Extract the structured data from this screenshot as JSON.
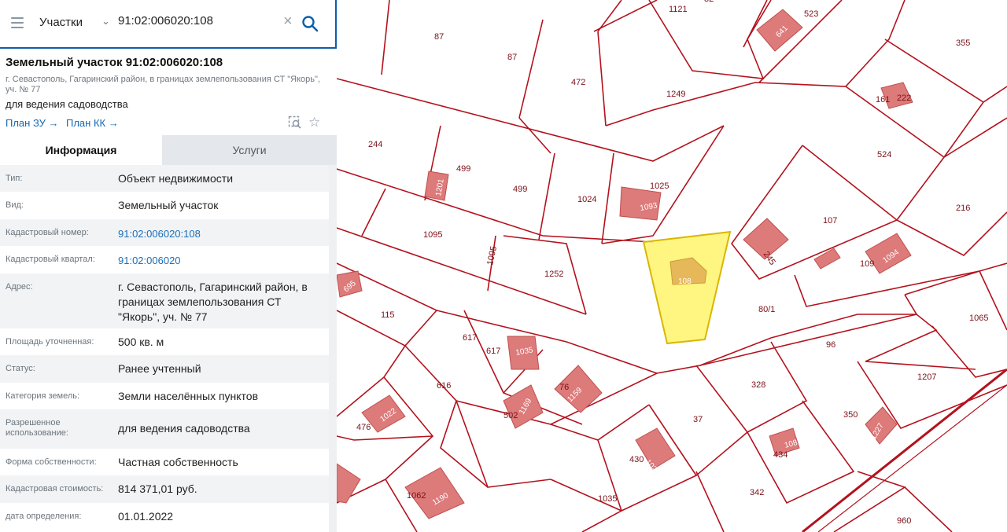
{
  "search": {
    "layer": "Участки",
    "value": "91:02:006020:108"
  },
  "object": {
    "title": "Земельный участок 91:02:006020:108",
    "address": "г. Севастополь, Гагаринский район, в границах землепользования СТ \"Якорь\", уч. № 77",
    "use": "для ведения садоводства",
    "links": [
      "План ЗУ",
      "План КК"
    ]
  },
  "tabs": [
    "Информация",
    "Услуги"
  ],
  "rows": [
    {
      "label": "Тип:",
      "value": "Объект недвижимости",
      "link": false
    },
    {
      "label": "Вид:",
      "value": "Земельный участок",
      "link": false
    },
    {
      "label": "Кадастровый номер:",
      "value": "91:02:006020:108",
      "link": true
    },
    {
      "label": "Кадастровый квартал:",
      "value": "91:02:006020",
      "link": true
    },
    {
      "label": "Адрес:",
      "value": "г. Севастополь, Гагаринский район, в границах землепользования СТ \"Якорь\", уч. № 77",
      "link": false
    },
    {
      "label": "Площадь уточненная:",
      "value": "500 кв. м",
      "link": false
    },
    {
      "label": "Статус:",
      "value": "Ранее учтенный",
      "link": false
    },
    {
      "label": "Категория земель:",
      "value": "Земли населённых пунктов",
      "link": false
    },
    {
      "label": "Разрешенное использование:",
      "value": "для ведения садоводства",
      "link": false
    },
    {
      "label": "Форма собственности:",
      "value": "Частная собственность",
      "link": false
    },
    {
      "label": "Кадастровая стоимость:",
      "value": "814 371,01 руб.",
      "link": false
    },
    {
      "label": "дата определения:",
      "value": "01.01.2022",
      "link": false
    }
  ],
  "map": {
    "parcel_labels": [
      "87",
      "87",
      "1121",
      "32",
      "523",
      "355",
      "472",
      "1249",
      "161",
      "222",
      "244",
      "499",
      "499",
      "1024",
      "1025",
      "524",
      "1095",
      "1095",
      "1252",
      "107",
      "216",
      "245",
      "109",
      "80/1",
      "115",
      "617",
      "617",
      "616",
      "76",
      "502",
      "476",
      "328",
      "96",
      "1065",
      "1207",
      "350",
      "37",
      "430",
      "434",
      "1062",
      "1035",
      "342",
      "960"
    ],
    "building_labels": [
      "641",
      "1201",
      "1093",
      "1094",
      "695",
      "1035",
      "1169",
      "1159",
      "1022",
      "1028",
      "1081",
      "1227",
      "1190"
    ],
    "selected_label": "108"
  },
  "colors": {
    "accent": "#0b5fa8",
    "parcel": "#b3121d",
    "building": "#dd7a7a",
    "selected": "#fff36b"
  }
}
